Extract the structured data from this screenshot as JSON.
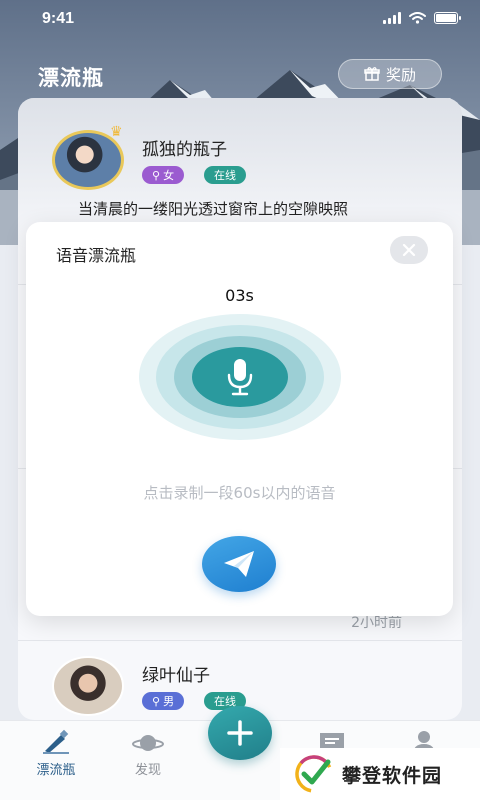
{
  "status_bar": {
    "time": "9:41"
  },
  "header": {
    "title": "漂流瓶",
    "reward_label": "奖励"
  },
  "entries": [
    {
      "username": "孤独的瓶子",
      "gender_tag": "女",
      "online_tag": "在线",
      "text": "当清晨的一缕阳光透过窗帘上的空隙映照"
    },
    {
      "username": "绿叶仙子",
      "gender_tag": "男",
      "online_tag": "在线"
    }
  ],
  "time_ago": "2小时前",
  "modal": {
    "title": "语音漂流瓶",
    "timer": "03s",
    "hint": "点击录制一段60s以内的语音"
  },
  "tabbar": {
    "tabs": [
      {
        "label": "漂流瓶",
        "icon": "bottle-icon"
      },
      {
        "label": "发现",
        "icon": "planet-icon"
      },
      {
        "label": "",
        "icon": "message-icon"
      },
      {
        "label": "",
        "icon": "profile-icon"
      }
    ],
    "fab_icon": "plus-icon"
  },
  "watermark": {
    "text": "攀登软件园",
    "icon": "check-logo-icon"
  },
  "colors": {
    "accent_teal": "#2a9a9e",
    "send_blue": "#1f7fd0",
    "tag_female": "#9b5bd0",
    "tag_male": "#5a6fd6",
    "tag_online": "#2a9d8f"
  }
}
